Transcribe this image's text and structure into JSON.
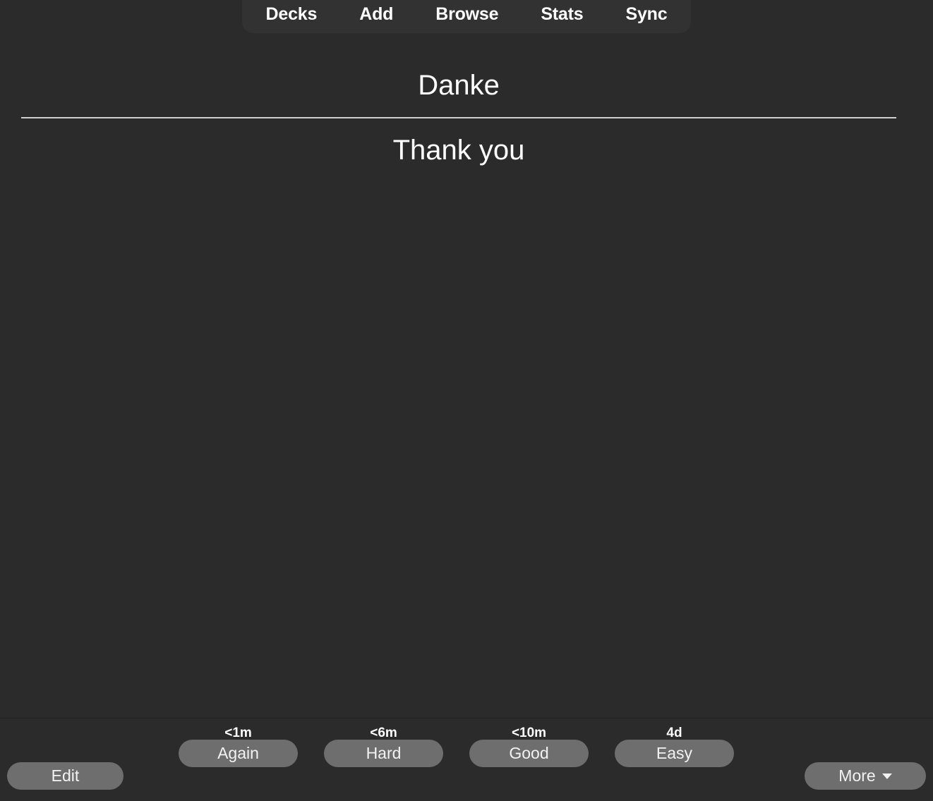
{
  "nav": {
    "items": [
      {
        "label": "Decks",
        "name": "nav-item-decks"
      },
      {
        "label": "Add",
        "name": "nav-item-add"
      },
      {
        "label": "Browse",
        "name": "nav-item-browse"
      },
      {
        "label": "Stats",
        "name": "nav-item-stats"
      },
      {
        "label": "Sync",
        "name": "nav-item-sync"
      }
    ]
  },
  "card": {
    "question": "Danke",
    "answer": "Thank you"
  },
  "answer_bar": {
    "edit_label": "Edit",
    "more_label": "More",
    "more_caret": "▾",
    "ratings": [
      {
        "interval": "<1m",
        "label": "Again"
      },
      {
        "interval": "<6m",
        "label": "Hard"
      },
      {
        "interval": "<10m",
        "label": "Good"
      },
      {
        "interval": "4d",
        "label": "Easy"
      }
    ]
  },
  "colors": {
    "page_background": "#2b2b2b",
    "nav_background": "#323232",
    "button_background": "#6e6e6e",
    "text": "#ffffff",
    "divider": "#cfcfcf"
  }
}
